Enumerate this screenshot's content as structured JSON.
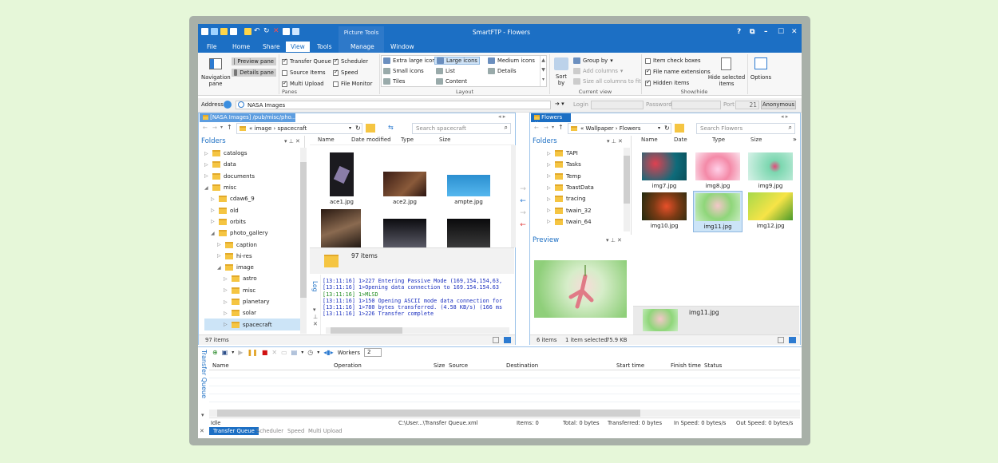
{
  "window": {
    "title": "SmartFTP - Flowers",
    "context_tab": "Picture Tools",
    "controls": {
      "help": "?",
      "restore": "⧉",
      "min": "–",
      "max": "☐",
      "close": "✕"
    }
  },
  "ribbon_tabs": [
    "File",
    "Home",
    "Share",
    "View",
    "Tools",
    "Manage",
    "Window"
  ],
  "ribbon": {
    "nav_pane": "Navigation pane",
    "preview_pane": "Preview pane",
    "details_pane": "Details pane",
    "panes_label": "Panes",
    "transfer_queue": "Transfer Queue",
    "scheduler": "Scheduler",
    "source_items": "Source Items",
    "speed": "Speed",
    "multi_upload": "Multi Upload",
    "file_monitor": "File Monitor",
    "layout": [
      "Extra large icons",
      "Large icons",
      "Medium icons",
      "Small icons",
      "List",
      "Details",
      "Tiles",
      "Content"
    ],
    "layout_label": "Layout",
    "sort_by": "Sort by",
    "group_by": "Group by",
    "add_columns": "Add columns",
    "size_all": "Size all columns to fit",
    "current_view_label": "Current view",
    "item_check_boxes": "Item check boxes",
    "file_name_ext": "File name extensions",
    "hidden_items": "Hidden items",
    "hide_selected": "Hide selected items",
    "showhide_label": "Show/hide",
    "options": "Options"
  },
  "address": {
    "label": "Address",
    "value": "NASA Images",
    "login": "Login",
    "password": "Password",
    "port": "Port",
    "port_value": "21",
    "anonymous": "Anonymous"
  },
  "left": {
    "tab": "[NASA Images] /pub/misc/pho...",
    "crumbs": "« image › spacecraft",
    "search": "Search spacecraft",
    "folders_title": "Folders",
    "tree": [
      {
        "label": "catalogs",
        "indent": 0
      },
      {
        "label": "data",
        "indent": 0
      },
      {
        "label": "documents",
        "indent": 0
      },
      {
        "label": "misc",
        "indent": 0,
        "open": true
      },
      {
        "label": "cdaw6_9",
        "indent": 1
      },
      {
        "label": "old",
        "indent": 1
      },
      {
        "label": "orbits",
        "indent": 1
      },
      {
        "label": "photo_gallery",
        "indent": 1,
        "open": true
      },
      {
        "label": "caption",
        "indent": 2
      },
      {
        "label": "hi-res",
        "indent": 2
      },
      {
        "label": "image",
        "indent": 2,
        "open": true
      },
      {
        "label": "astro",
        "indent": 3
      },
      {
        "label": "misc",
        "indent": 3
      },
      {
        "label": "planetary",
        "indent": 3
      },
      {
        "label": "solar",
        "indent": 3
      },
      {
        "label": "spacecraft",
        "indent": 3,
        "selected": true
      }
    ],
    "cols": [
      "Name",
      "Date modified",
      "Type",
      "Size"
    ],
    "files": [
      "ace1.jpg",
      "ace2.jpg",
      "ampte.jpg"
    ],
    "count_label": "97 items",
    "log_label": "Log",
    "log": [
      {
        "text": "[13:11:16] 1>227 Entering Passive Mode (169,154,154,63,",
        "c": "#1a2fbf"
      },
      {
        "text": "[13:11:16] 1>Opening data connection to 169.154.154.63",
        "c": "#1a2fbf"
      },
      {
        "text": "[13:11:16] 1>MLSD",
        "c": "#1d8a1d"
      },
      {
        "text": "[13:11:16] 1>150 Opening ASCII mode data connection for",
        "c": "#1a2fbf"
      },
      {
        "text": "[13:11:16] 1>780 bytes transferred. (4.58 KB/s) (166 ms",
        "c": "#1a2fbf"
      },
      {
        "text": "[13:11:16] 1>226 Transfer complete",
        "c": "#1a2fbf"
      }
    ],
    "status": "97 items"
  },
  "right": {
    "tab": "Flowers",
    "crumbs": "« Wallpaper › Flowers",
    "search": "Search Flowers",
    "folders_title": "Folders",
    "tree": [
      {
        "label": "TAPI"
      },
      {
        "label": "Tasks"
      },
      {
        "label": "Temp"
      },
      {
        "label": "ToastData"
      },
      {
        "label": "tracing"
      },
      {
        "label": "twain_32"
      },
      {
        "label": "twain_64"
      }
    ],
    "cols": [
      "Name",
      "Date",
      "Type",
      "Size"
    ],
    "files": [
      "img7.jpg",
      "img8.jpg",
      "img9.jpg",
      "img10.jpg",
      "img11.jpg",
      "img12.jpg"
    ],
    "preview_title": "Preview",
    "selected_name": "img11.jpg",
    "status_items": "6 items",
    "status_sel": "1 item selected",
    "status_size": "75.9 KB"
  },
  "queue": {
    "title": "Transfer Queue",
    "workers_label": "Workers",
    "workers": "2",
    "cols": [
      "Name",
      "Operation",
      "Size",
      "Source",
      "Destination",
      "Start time",
      "Finish time",
      "Status"
    ],
    "status": {
      "idle": "Idle",
      "file": "C:\\User...\\Transfer Queue.xml",
      "items": "Items: 0",
      "total": "Total: 0 bytes",
      "transferred": "Transferred: 0 bytes",
      "in": "In Speed: 0 bytes/s",
      "out": "Out Speed: 0 bytes/s"
    },
    "bottom_tabs": [
      "Transfer Queue",
      "Scheduler",
      "Speed",
      "Multi Upload"
    ]
  },
  "colors": {
    "accent": "#1c6fc4",
    "selection": "#cce4f7"
  }
}
